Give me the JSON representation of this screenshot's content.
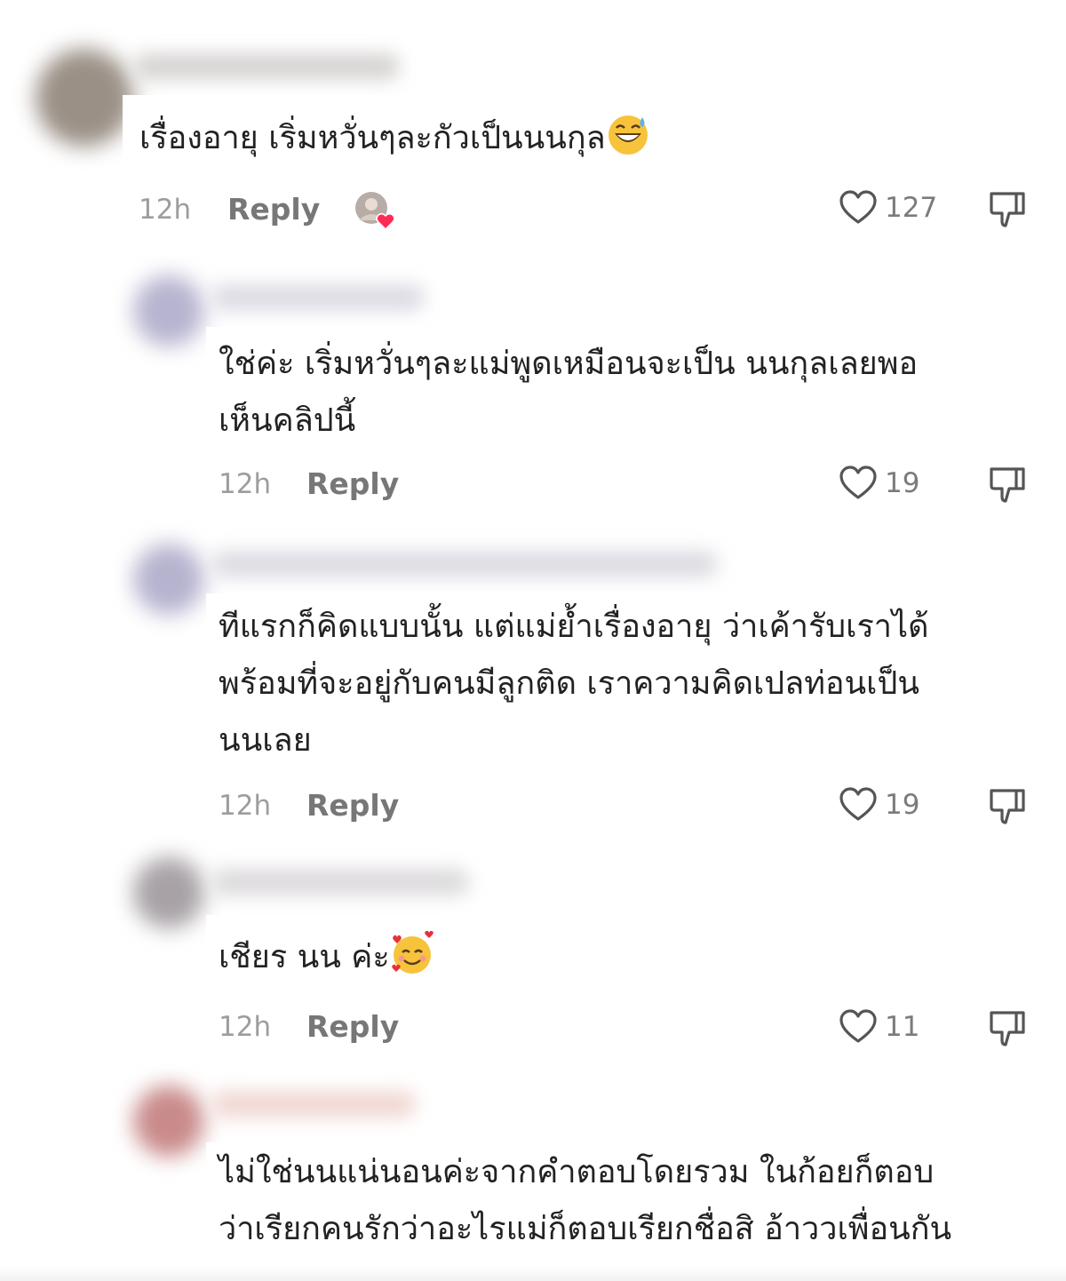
{
  "comments": [
    {
      "text": "เรื่องอายุ เริ่มหวั่นๆละกัวเป็นนนกุล",
      "emoji": "grinning-sweat",
      "time": "12h",
      "reply_label": "Reply",
      "likes": "127"
    },
    {
      "text": "ใช่ค่ะ เริ่มหวั่นๆละแม่พูดเหมือนจะเป็น นนกุลเลยพอ\nเห็นคลิปนี้",
      "time": "12h",
      "reply_label": "Reply",
      "likes": "19"
    },
    {
      "text": "ทีแรกก็คิดแบบนั้น แต่แม่ย้ำเรื่องอายุ ว่าเค้ารับเราได้\nพร้อมที่จะอยู่กับคนมีลูกติด เราความคิดเปลท่อนเป็น\nนนเลย",
      "time": "12h",
      "reply_label": "Reply",
      "likes": "19"
    },
    {
      "text": "เชียร นน ค่ะ",
      "emoji": "smiling-face-with-hearts",
      "time": "12h",
      "reply_label": "Reply",
      "likes": "11"
    },
    {
      "text": "ไม่ใช่นนแน่นอนค่ะจากคำตอบโดยรวม ในก้อยก็ตอบ\nว่าเรียกคนรักว่าอะไรแม่ก็ตอบเรียกชื่อสิ อ้าววเพื่อนกัน"
    }
  ],
  "icons": {
    "like": "heart-outline-icon",
    "dislike": "thumb-down-outline-icon",
    "creator_liked": "creator-liked-avatar-heart-icon"
  },
  "colors": {
    "text": "#222222",
    "meta": "#9d9d9d",
    "reply": "#777777",
    "heart_badge": "#fe2c55"
  }
}
